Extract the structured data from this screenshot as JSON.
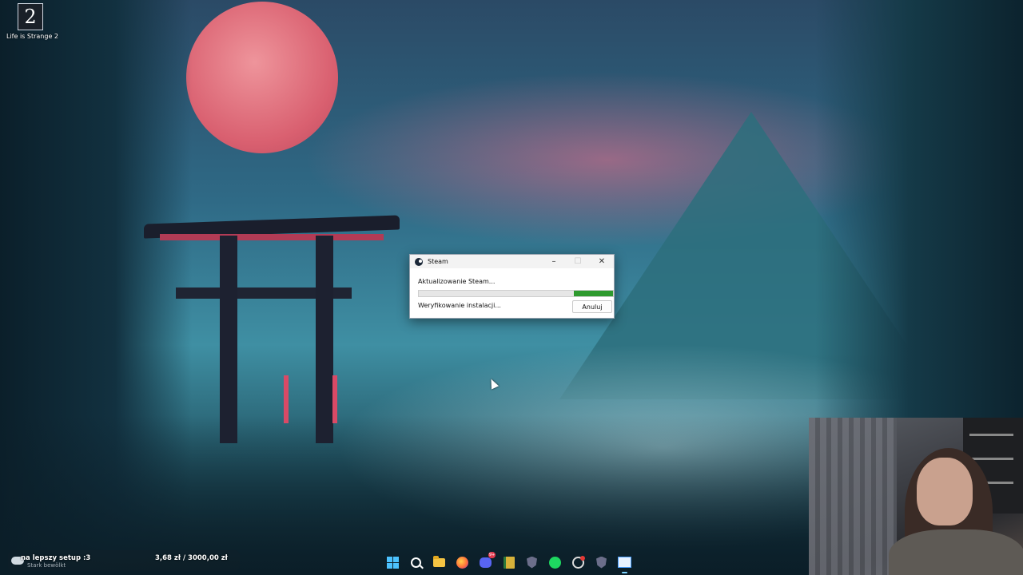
{
  "desktop": {
    "icons": [
      {
        "label": "Life is Strange 2",
        "glyph": "2"
      }
    ]
  },
  "dialog": {
    "title": "Steam",
    "status_text": "Aktualizowanie Steam...",
    "progress_fraction": 0.2,
    "detail_text": "Weryfikowanie instalacji...",
    "cancel_label": "Anuluj",
    "minimize_glyph": "–",
    "maximize_glyph": "☐",
    "close_glyph": "✕"
  },
  "widget": {
    "goal_title": "na lepszy setup :3",
    "goal_sub": "Stark bewölkt",
    "goal_amount": "3,68 zł / 3000,00 zł"
  },
  "taskbar": {
    "icons": [
      "windows-start-icon",
      "search-icon",
      "file-explorer-icon",
      "firefox-icon",
      "discord-icon",
      "sheet-app-icon",
      "shield-app-icon",
      "spotify-icon",
      "obs-icon",
      "shield-app-2-icon",
      "active-window-icon"
    ],
    "discord_badge": "9+",
    "accent": "#4cc2ff"
  }
}
